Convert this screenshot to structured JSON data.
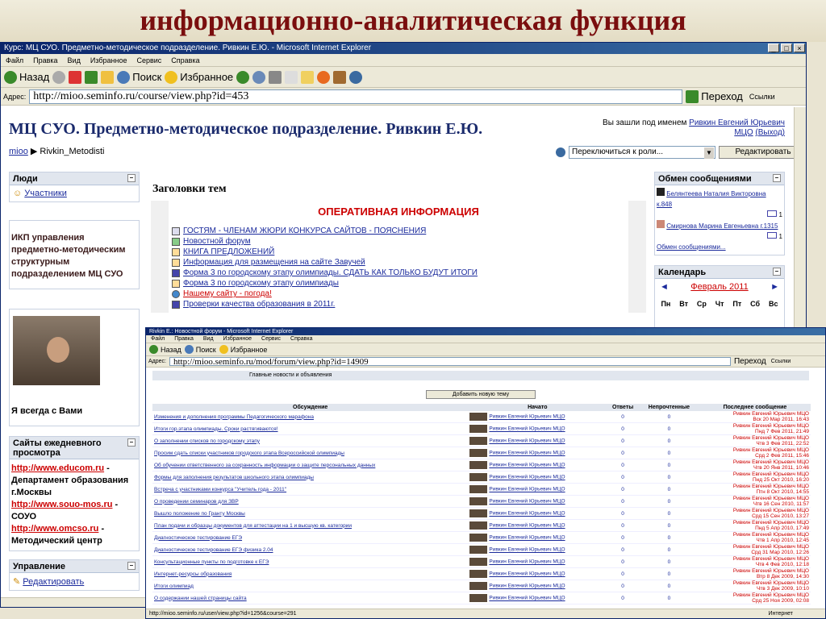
{
  "slide": {
    "title": "информационно-аналитическая функция"
  },
  "window1": {
    "title": "Курс: МЦ СУО. Предметно-методическое подразделение. Ривкин Е.Ю. - Microsoft Internet Explorer",
    "menu": [
      "Файл",
      "Правка",
      "Вид",
      "Избранное",
      "Сервис",
      "Справка"
    ],
    "toolbar": {
      "back": "Назад",
      "search": "Поиск",
      "favorites": "Избранное"
    },
    "address_label": "Адрес:",
    "url": "http://mioo.seminfo.ru/course/view.php?id=453",
    "go": "Переход",
    "links": "Ссылки",
    "site_title": "МЦ СУО. Предметно-методическое подразделение. Ривкин Е.Ю.",
    "login_prefix": "Вы зашли под именем",
    "login_user": "Ривкин Евгений Юрьевич МЦО",
    "logout": "(Выход)",
    "breadcrumb_home": "mioo",
    "breadcrumb_current": "▶ Rivkin_Metodisti",
    "role_placeholder": "Переключиться к роли...",
    "edit_button": "Редактировать",
    "left": {
      "people_title": "Люди",
      "participants": "Участники",
      "ikp_text": "ИКП управления предметно-методическим структурным подразделением МЦ СУО",
      "always_with_you": "Я всегда с Вами",
      "sites_title": "Сайты ежедневного просмотра",
      "site1_url": "http://www.educom.ru",
      "site1_desc": "- Департамент образования г.Москвы",
      "site2_url": "http://www.souo-mos.ru",
      "site2_desc": "- СОУО",
      "site3_url": "http://www.omcso.ru",
      "site3_desc": "- Методический центр",
      "manage_title": "Управление",
      "manage_edit": "Редактировать"
    },
    "main": {
      "topics_title": "Заголовки тем",
      "info_title": "ОПЕРАТИВНАЯ ИНФОРМАЦИЯ",
      "resources": [
        "ГОСТЯМ - ЧЛЕНАМ ЖЮРИ КОНКУРСА САЙТОВ - ПОЯСНЕНИЯ",
        "Новостной форум",
        "КНИГА ПРЕДЛОЖЕНИЙ",
        "Информация для размещения на сайте Завучей",
        "Форма 3 по городскому этапу олимпиады. СДАТЬ КАК ТОЛЬКО БУДУТ ИТОГИ",
        "Форма 3 по городскому этапу олимпиады",
        "Нашему сайту - погода!",
        "Проверки качества образования в 2011г."
      ]
    },
    "right": {
      "messages_title": "Обмен сообщениями",
      "msg1": "Белянтеева Наталия Викторовна к.848",
      "msg2": "Смирнова Марина Евгеньевна г.1315",
      "msg_link": "Обмен сообщениями...",
      "calendar_title": "Календарь",
      "month": "Февраль 2011",
      "weekdays": [
        "Пн",
        "Вт",
        "Ср",
        "Чт",
        "Пт",
        "Сб",
        "Вс"
      ]
    }
  },
  "window2": {
    "title": "Rivkin E.: Новостной форум - Microsoft Internet Explorer",
    "menu": [
      "Файл",
      "Правка",
      "Вид",
      "Избранное",
      "Сервис",
      "Справка"
    ],
    "toolbar": {
      "back": "Назад",
      "search": "Поиск",
      "favorites": "Избранное"
    },
    "address_label": "Адрес:",
    "url": "http://mioo.seminfo.ru/mod/forum/view.php?id=14909",
    "go": "Переход",
    "links": "Ссылки",
    "forum_header": "Главные новости и объявления",
    "add_topic": "Добавить новую тему",
    "columns": [
      "Обсуждение",
      "Начато",
      "Ответы",
      "Непрочтенные",
      "Последнее сообщение"
    ],
    "author": "Ривкин Евгений Юрьевич МЦО",
    "rows": [
      {
        "topic": "Изменения и дополнения программы Педагогического марафона",
        "replies": "0",
        "unread": "0",
        "last": "Ривкин Евгений Юрьевич МЦО\nВск 20 Мар 2011, 16:43"
      },
      {
        "topic": "Итоги гор.этапа олимпиады. Сроки растягиваются!",
        "replies": "0",
        "unread": "0",
        "last": "Ривкин Евгений Юрьевич МЦО\nПнд 7 Фев 2011, 21:49"
      },
      {
        "topic": "О заполнении списков по городскому этапу",
        "replies": "0",
        "unread": "0",
        "last": "Ривкин Евгений Юрьевич МЦО\nЧтв 3 Фев 2011, 22:52"
      },
      {
        "topic": "Просим сдать списки участников городского этапа Всероссийской олимпиады",
        "replies": "0",
        "unread": "0",
        "last": "Ривкин Евгений Юрьевич МЦО\nСрд 2 Фев 2011, 15:46"
      },
      {
        "topic": "Об обучении ответственного за сохранность информации о защите персональных данных",
        "replies": "0",
        "unread": "0",
        "last": "Ривкин Евгений Юрьевич МЦО\nЧтв 20 Янв 2011, 10:46"
      },
      {
        "topic": "Формы для заполнения результатов школьного этапа олимпиады",
        "replies": "0",
        "unread": "0",
        "last": "Ривкин Евгений Юрьевич МЦО\nПнд 25 Окт 2010, 16:20"
      },
      {
        "topic": "Встреча с участниками конкурса \"Учитель года - 2011\"",
        "replies": "0",
        "unread": "0",
        "last": "Ривкин Евгений Юрьевич МЦО\nПтн 8 Окт 2010, 14:55"
      },
      {
        "topic": "О проведении семинаров для ЗВР",
        "replies": "0",
        "unread": "0",
        "last": "Ривкин Евгений Юрьевич МЦО\nЧтв 16 Сен 2010, 11:57"
      },
      {
        "topic": "Вышло положение по Гранту Москвы",
        "replies": "0",
        "unread": "0",
        "last": "Ривкин Евгений Юрьевич МЦО\nСрд 15 Сен 2010, 13:27"
      },
      {
        "topic": "План подачи и образцы документов для аттестации на 1 и высшую кв. категории",
        "replies": "0",
        "unread": "0",
        "last": "Ривкин Евгений Юрьевич МЦО\nПнд 5 Апр 2010, 17:49"
      },
      {
        "topic": "Диагностическое тестирование ЕГЭ",
        "replies": "0",
        "unread": "0",
        "last": "Ривкин Евгений Юрьевич МЦО\nЧтв 1 Апр 2010, 12:45"
      },
      {
        "topic": "Диагностическое тестирование ЕГЭ физика 2.04",
        "replies": "0",
        "unread": "0",
        "last": "Ривкин Евгений Юрьевич МЦО\nСрд 31 Мар 2010, 12:26"
      },
      {
        "topic": "Консультационные пункты по подготовке к ЕГЭ",
        "replies": "0",
        "unread": "0",
        "last": "Ривкин Евгений Юрьевич МЦО\nЧтв 4 Фев 2010, 12:18"
      },
      {
        "topic": "Интернет-ресурсы образования",
        "replies": "0",
        "unread": "0",
        "last": "Ривкин Евгений Юрьевич МЦО\nВтр 8 Дек 2009, 14:30"
      },
      {
        "topic": "Итоги олимпиад",
        "replies": "0",
        "unread": "0",
        "last": "Ривкин Евгений Юрьевич МЦО\nЧтв 3 Дек 2009, 10:10"
      },
      {
        "topic": "О содержании нашей страницы сайта",
        "replies": "0",
        "unread": "0",
        "last": "Ривкин Евгений Юрьевич МЦО\nСрд 25 Ноя 2009, 02:08"
      }
    ],
    "status_url": "http://mioo.seminfo.ru/user/view.php?id=1256&course=291",
    "status_zone": "Интернет"
  }
}
